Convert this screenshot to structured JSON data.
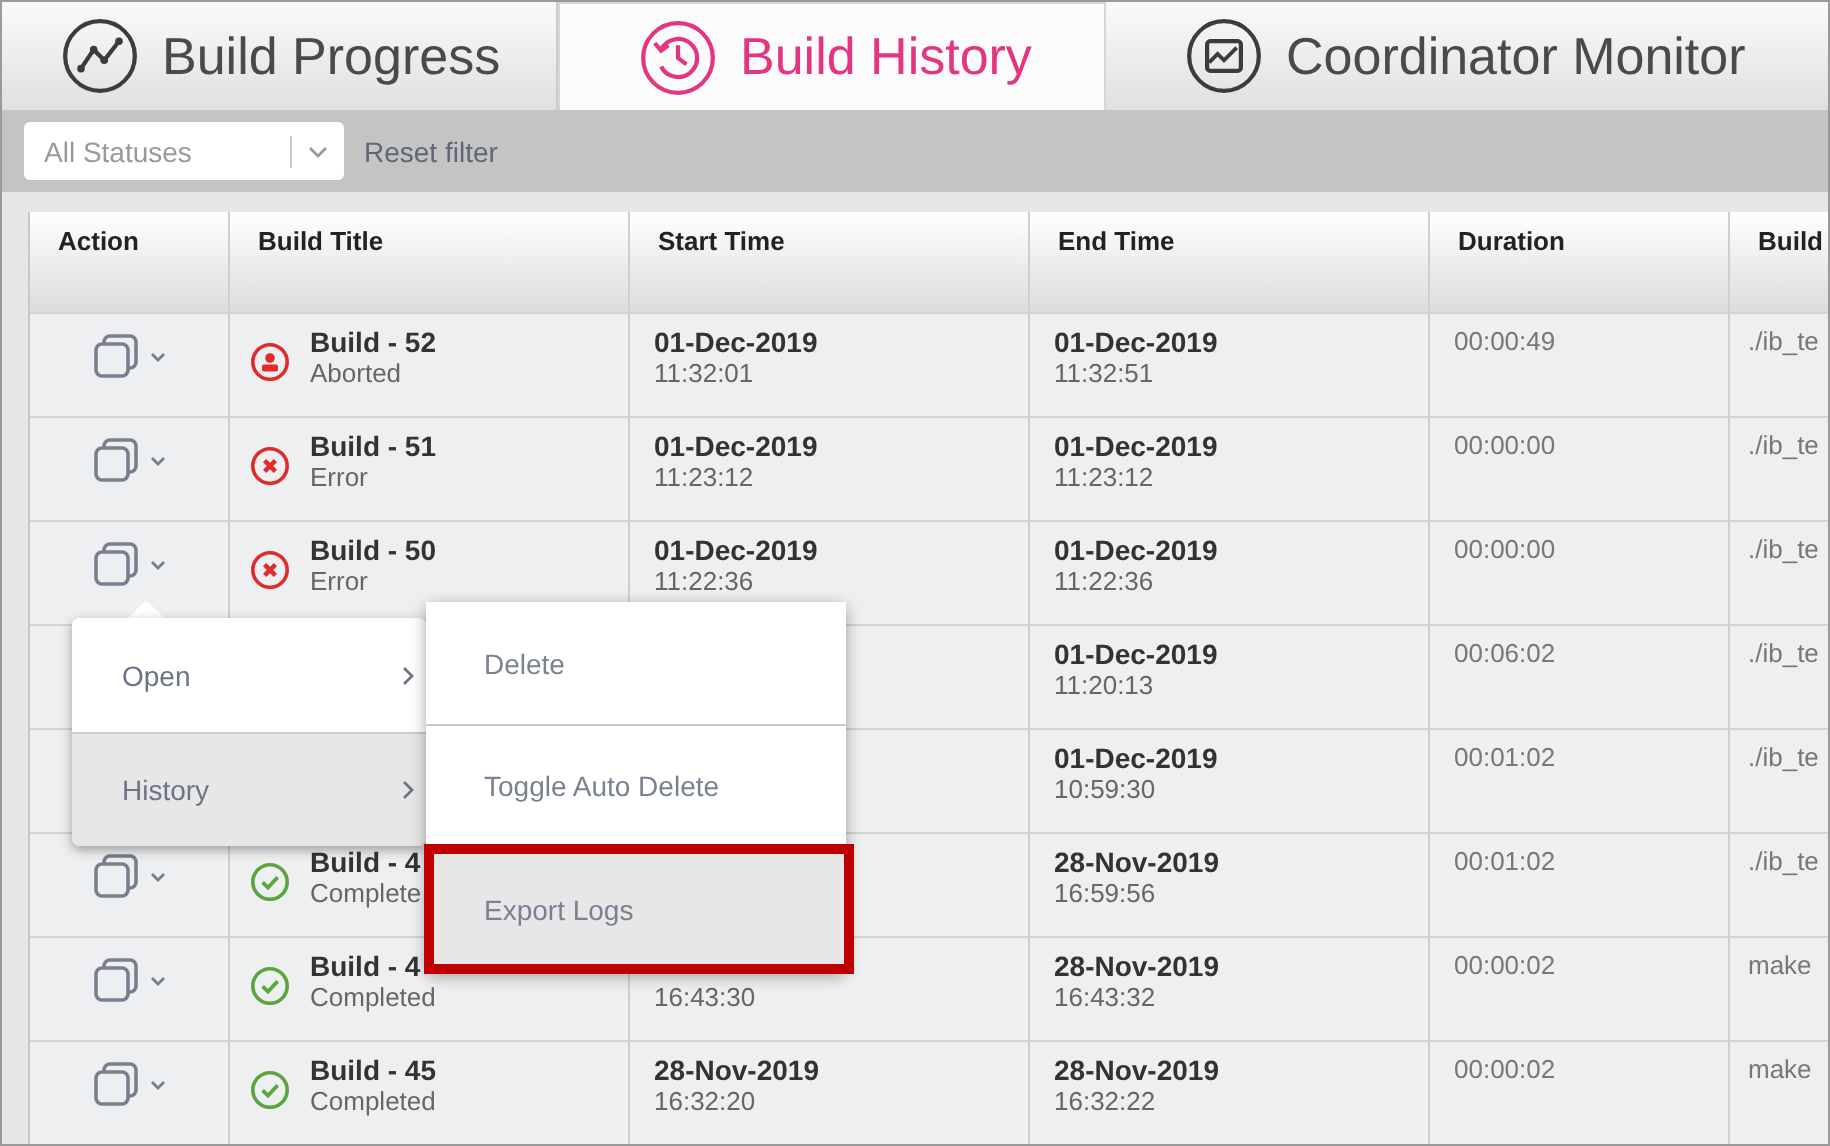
{
  "tabs": [
    {
      "label": "Build Progress",
      "kind": "progress",
      "selected": false
    },
    {
      "label": "Build History",
      "kind": "history",
      "selected": true
    },
    {
      "label": "Coordinator Monitor",
      "kind": "monitor",
      "selected": false
    }
  ],
  "filter": {
    "placeholder": "All Statuses",
    "reset": "Reset filter"
  },
  "table": {
    "columns": [
      "Action",
      "Build Title",
      "Start Time",
      "End Time",
      "Duration",
      "Build"
    ],
    "rows": [
      {
        "action_icon": true,
        "title": "Build - 52",
        "status": "Aborted",
        "kind": "aborted",
        "start_date": "01-Dec-2019",
        "start_time": "11:32:01",
        "end_date": "01-Dec-2019",
        "end_time": "11:32:51",
        "duration": "00:00:49",
        "build": "./ib_te"
      },
      {
        "action_icon": true,
        "title": "Build - 51",
        "status": "Error",
        "kind": "error",
        "start_date": "01-Dec-2019",
        "start_time": "11:23:12",
        "end_date": "01-Dec-2019",
        "end_time": "11:23:12",
        "duration": "00:00:00",
        "build": "./ib_te"
      },
      {
        "action_icon": true,
        "title": "Build - 50",
        "status": "Error",
        "kind": "error",
        "start_date": "01-Dec-2019",
        "start_time": "11:22:36",
        "end_date": "01-Dec-2019",
        "end_time": "11:22:36",
        "duration": "00:00:00",
        "build": "./ib_te"
      },
      {
        "action_icon": false,
        "end_date": "01-Dec-2019",
        "end_time": "11:20:13",
        "duration": "00:06:02",
        "build": "./ib_te"
      },
      {
        "action_icon": false,
        "end_date": "01-Dec-2019",
        "end_time": "10:59:30",
        "duration": "00:01:02",
        "build": "./ib_te"
      },
      {
        "action_icon": true,
        "title": "Build - 4",
        "status": "Complete",
        "kind": "completed",
        "end_date": "28-Nov-2019",
        "end_time": "16:59:56",
        "duration": "00:01:02",
        "build": "./ib_te"
      },
      {
        "action_icon": true,
        "title": "Build - 4",
        "status": "Completed",
        "kind": "completed",
        "start_time": "16:43:30",
        "end_date": "28-Nov-2019",
        "end_time": "16:43:32",
        "duration": "00:00:02",
        "build": "make"
      },
      {
        "action_icon": true,
        "title": "Build - 45",
        "status": "Completed",
        "kind": "completed",
        "start_date": "28-Nov-2019",
        "start_time": "16:32:20",
        "end_date": "28-Nov-2019",
        "end_time": "16:32:22",
        "duration": "00:00:02",
        "build": "make"
      }
    ]
  },
  "context_menu": {
    "items": [
      {
        "label": "Open",
        "selected": false
      },
      {
        "label": "History",
        "selected": true
      }
    ]
  },
  "submenu": {
    "items": [
      {
        "label": "Delete",
        "selected": false,
        "highlighted": false
      },
      {
        "label": "Toggle Auto Delete",
        "selected": false,
        "highlighted": false
      },
      {
        "label": "Export Logs",
        "selected": true,
        "highlighted": true
      }
    ]
  }
}
